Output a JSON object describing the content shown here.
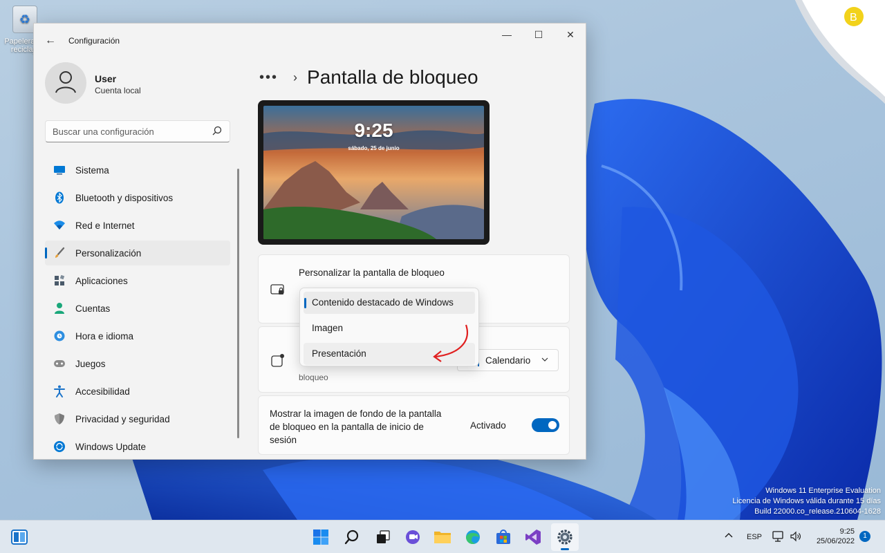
{
  "desktop": {
    "recycle_bin_label": "Papelera de reciclaje",
    "eval_lines": [
      "Windows 11 Enterprise Evaluation",
      "Licencia de Windows válida durante 15 días",
      "Build 22000.co_release.210604-1628"
    ]
  },
  "window": {
    "title": "Configuración",
    "controls": {
      "minimize": "—",
      "maximize": "☐",
      "close": "✕"
    },
    "back_glyph": "←"
  },
  "profile": {
    "name": "User",
    "subtitle": "Cuenta local"
  },
  "search": {
    "placeholder": "Buscar una configuración"
  },
  "nav": {
    "items": [
      {
        "label": "Sistema",
        "icon": "monitor-icon",
        "color": "#0078d4"
      },
      {
        "label": "Bluetooth y dispositivos",
        "icon": "bluetooth-icon",
        "color": "#0078d4"
      },
      {
        "label": "Red e Internet",
        "icon": "wifi-icon",
        "color": "#0078d4"
      },
      {
        "label": "Personalización",
        "icon": "brush-icon",
        "color": "#e8a23c",
        "active": true
      },
      {
        "label": "Aplicaciones",
        "icon": "apps-icon",
        "color": "#4a5a6a"
      },
      {
        "label": "Cuentas",
        "icon": "person-icon",
        "color": "#1aa77a"
      },
      {
        "label": "Hora e idioma",
        "icon": "globe-clock-icon",
        "color": "#0078d4"
      },
      {
        "label": "Juegos",
        "icon": "gamepad-icon",
        "color": "#6b6b6b"
      },
      {
        "label": "Accesibilidad",
        "icon": "accessibility-icon",
        "color": "#1a73c9"
      },
      {
        "label": "Privacidad y seguridad",
        "icon": "shield-icon",
        "color": "#6b6b6b"
      },
      {
        "label": "Windows Update",
        "icon": "update-icon",
        "color": "#0078d4"
      }
    ]
  },
  "content": {
    "breadcrumb_dots": "•••",
    "breadcrumb_chevron": "›",
    "page_title": "Pantalla de bloqueo",
    "preview": {
      "time": "9:25",
      "date": "sábado, 25 de junio"
    },
    "card1": {
      "label": "Personalizar la pantalla de bloqueo"
    },
    "card2": {
      "label_visible": "bloqueo",
      "select_value": "Calendario"
    },
    "card3": {
      "label": "Mostrar la imagen de fondo de la pantalla de bloqueo en la pantalla de inicio de sesión",
      "toggle_label": "Activado",
      "toggle_on": true
    },
    "dropdown": {
      "options": [
        {
          "label": "Contenido destacado de Windows",
          "selected": true
        },
        {
          "label": "Imagen",
          "selected": false
        },
        {
          "label": "Presentación",
          "selected": false,
          "hovered": true
        }
      ]
    }
  },
  "taskbar": {
    "apps": [
      {
        "name": "start-icon"
      },
      {
        "name": "search-icon"
      },
      {
        "name": "task-view-icon"
      },
      {
        "name": "chat-icon"
      },
      {
        "name": "file-explorer-icon"
      },
      {
        "name": "edge-icon"
      },
      {
        "name": "store-icon"
      },
      {
        "name": "visual-studio-icon"
      },
      {
        "name": "settings-icon",
        "active": true
      }
    ],
    "tray": {
      "language": "ESP",
      "time": "9:25",
      "date": "25/06/2022",
      "notification_count": "1"
    }
  },
  "colors": {
    "accent": "#0067c0",
    "wallpaper_blue": "#1746c4"
  }
}
